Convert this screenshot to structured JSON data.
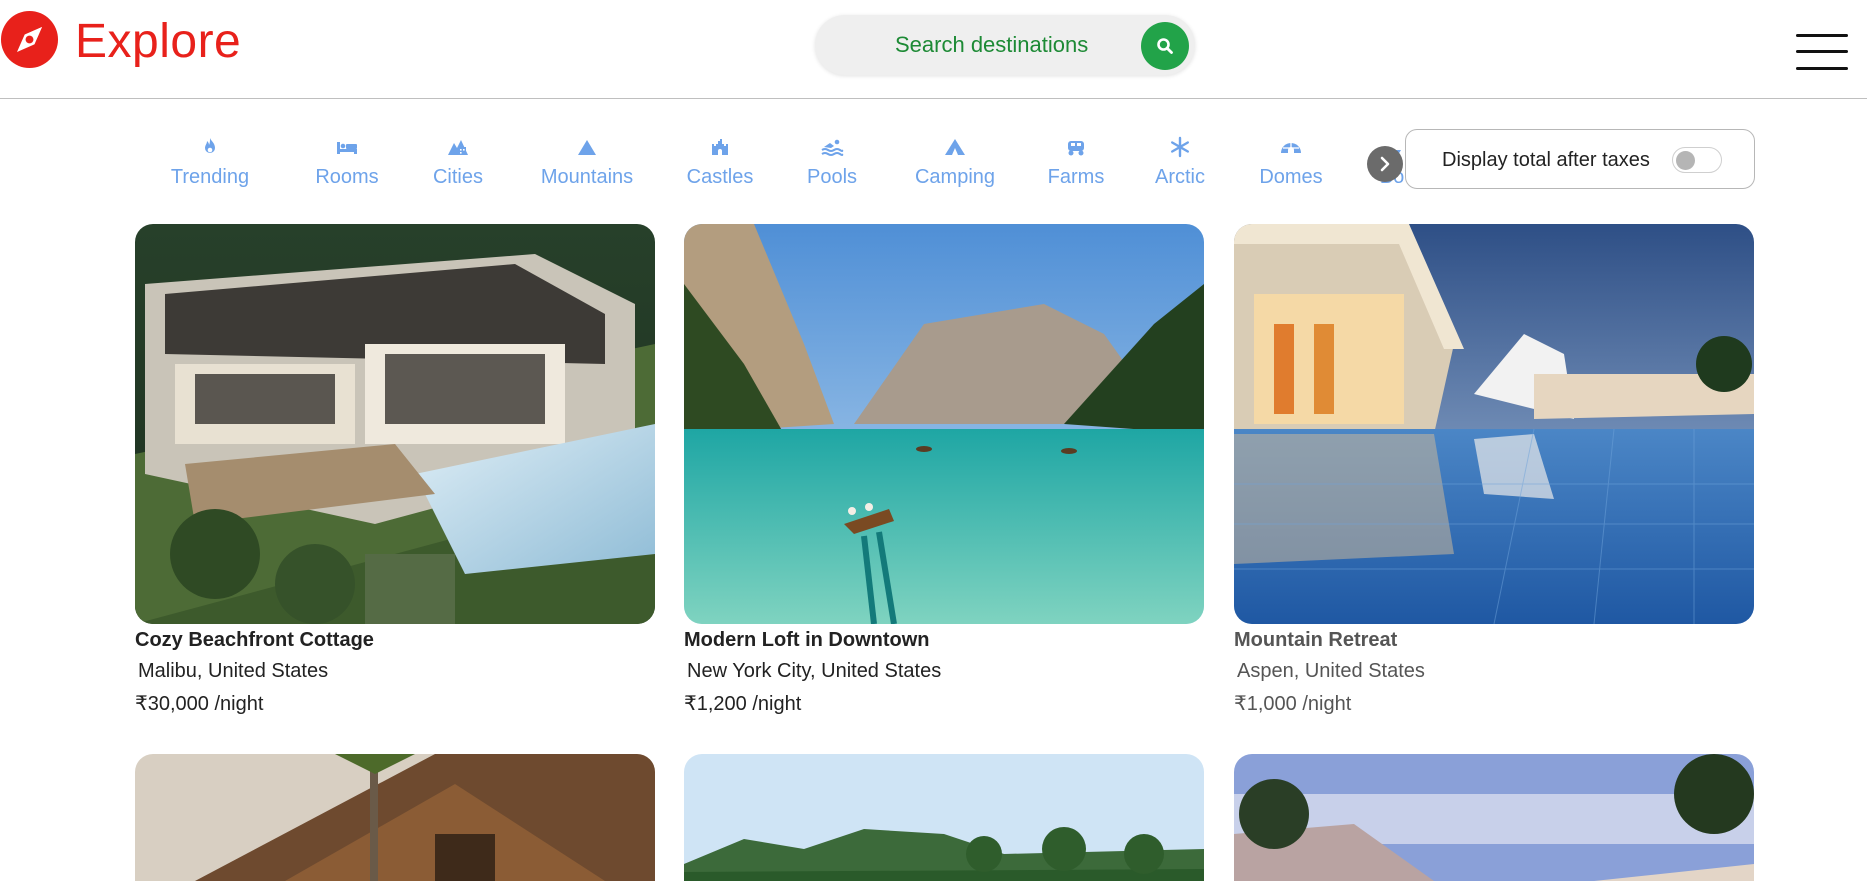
{
  "header": {
    "brand": "Explore",
    "logo_icon": "compass-icon",
    "search_placeholder": "Search destinations",
    "search_icon": "search-icon",
    "menu_icon": "hamburger-menu-icon",
    "brand_color": "#e8211b",
    "search_accent": "#22a349"
  },
  "filters": [
    {
      "label": "Trending",
      "icon": "fire-icon"
    },
    {
      "label": "Rooms",
      "icon": "bed-icon"
    },
    {
      "label": "Cities",
      "icon": "city-icon"
    },
    {
      "label": "Mountains",
      "icon": "mountain-icon"
    },
    {
      "label": "Castles",
      "icon": "castle-icon"
    },
    {
      "label": "Pools",
      "icon": "swimmer-icon"
    },
    {
      "label": "Camping",
      "icon": "tent-icon"
    },
    {
      "label": "Farms",
      "icon": "tractor-icon"
    },
    {
      "label": "Arctic",
      "icon": "snowflake-icon"
    },
    {
      "label": "Domes",
      "icon": "igloo-icon"
    },
    {
      "label": "Bo",
      "icon": "boat-icon"
    }
  ],
  "filter_color": "#6ea3ea",
  "tax_toggle": {
    "label": "Display total after taxes",
    "enabled": false
  },
  "listings": [
    {
      "title": "Cozy Beachfront Cottage",
      "location": "Malibu, United States",
      "price": "₹30,000 /night",
      "image": "modern-villa-with-pool"
    },
    {
      "title": "Modern Loft in Downtown",
      "location": "New York City, United States",
      "price": "₹1,200 /night",
      "image": "mountain-lake-with-boat"
    },
    {
      "title": "Mountain Retreat",
      "location": "Aspen, United States",
      "price": "₹1,000 /night",
      "image": "resort-pool-at-dusk"
    },
    {
      "title": "",
      "location": "",
      "price": "",
      "image": "wooden-cabin-with-palm"
    },
    {
      "title": "",
      "location": "",
      "price": "",
      "image": "tropical-bay-with-palms"
    },
    {
      "title": "",
      "location": "",
      "price": "",
      "image": "sunset-beach-resort"
    }
  ]
}
